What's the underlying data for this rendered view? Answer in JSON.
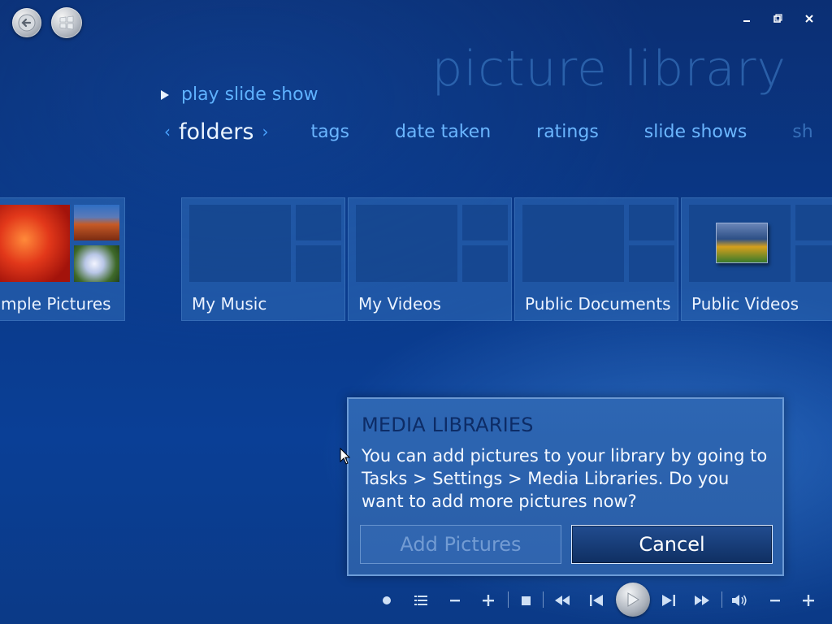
{
  "page": {
    "title": "picture library"
  },
  "nav": {
    "play_slide_show": "play slide show"
  },
  "tabs": [
    {
      "label": "folders",
      "active": true
    },
    {
      "label": "tags"
    },
    {
      "label": "date taken"
    },
    {
      "label": "ratings"
    },
    {
      "label": "slide shows"
    },
    {
      "label": "sh"
    }
  ],
  "folders": [
    {
      "label": "mple Pictures"
    },
    {
      "label": "My Music"
    },
    {
      "label": "My Videos"
    },
    {
      "label": "Public Documents"
    },
    {
      "label": "Public Videos"
    }
  ],
  "dialog": {
    "title": "MEDIA LIBRARIES",
    "message": "You can add pictures to your library by going to Tasks > Settings > Media Libraries. Do you want to add more pictures now?",
    "add_button": "Add Pictures",
    "cancel_button": "Cancel"
  },
  "colors": {
    "accent": "#5fb2ff",
    "background": "#0a3a8b",
    "dialog": "#2d66b3"
  }
}
